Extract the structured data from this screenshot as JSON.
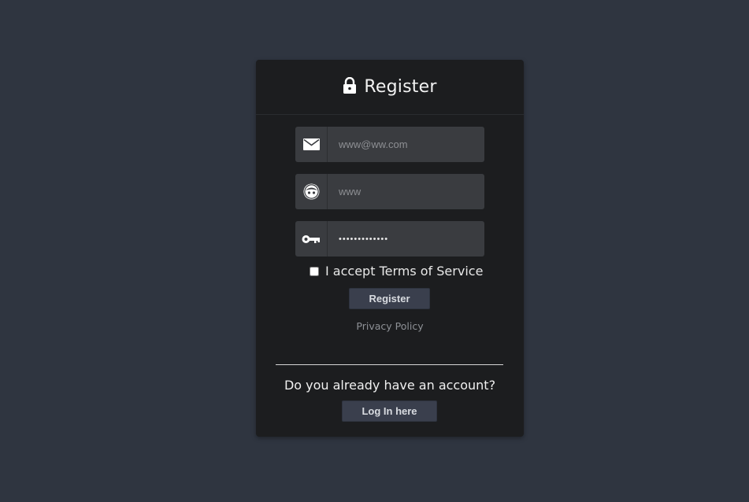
{
  "header": {
    "title": "Register",
    "icon": "lock-icon"
  },
  "form": {
    "email": {
      "icon": "envelope-icon",
      "placeholder": "www@ww.com",
      "value": ""
    },
    "username": {
      "icon": "face-icon",
      "placeholder": "www",
      "value": ""
    },
    "password": {
      "icon": "key-icon",
      "placeholder": "",
      "value": "•••••••••••••"
    },
    "terms_label": "I accept Terms of Service",
    "terms_checked": false,
    "register_label": "Register",
    "privacy_label": "Privacy Policy"
  },
  "footer": {
    "question": "Do you already have an account?",
    "login_label": "Log In here"
  },
  "colors": {
    "background": "#2f3540",
    "card": "#1c1d1f",
    "field": "#3a3c40",
    "button": "#3a3f4d"
  }
}
